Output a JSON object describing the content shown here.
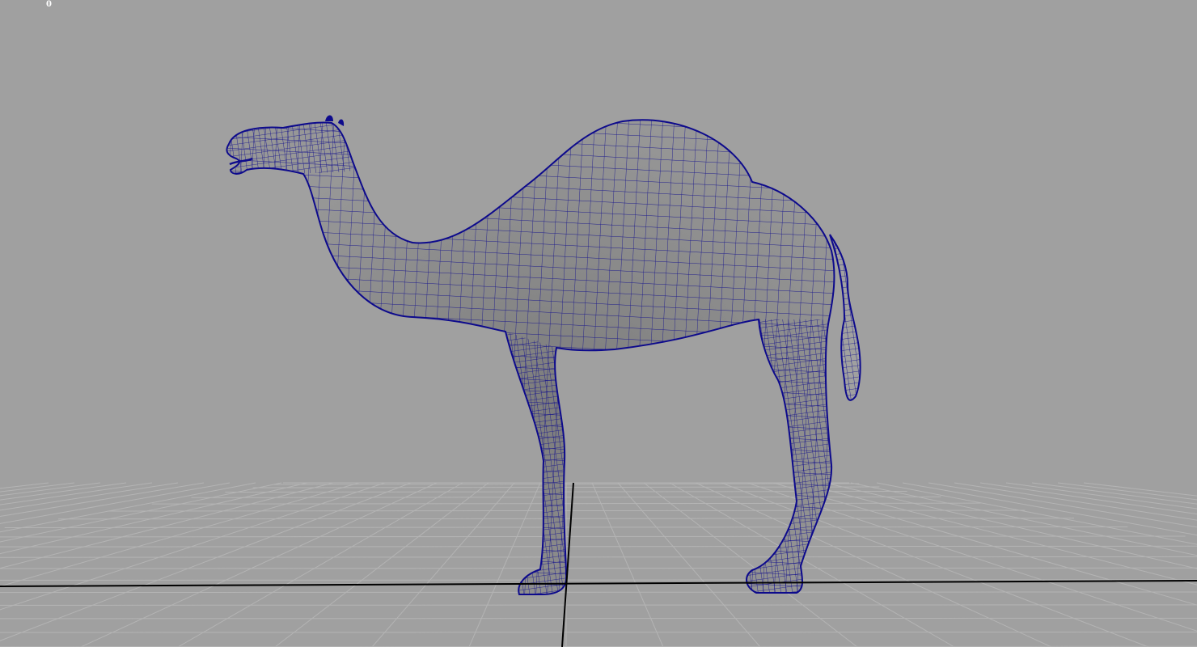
{
  "viewport": {
    "name": "3d-viewport",
    "background": "#a0a0a0",
    "hud": {
      "counter": "0"
    },
    "grid": {
      "line_color": "#b4b4b4",
      "axis_color": "#000000"
    },
    "model": {
      "name": "camel",
      "wire_color": "#0d0a8c",
      "shade_color": "#8a8a8a"
    }
  }
}
